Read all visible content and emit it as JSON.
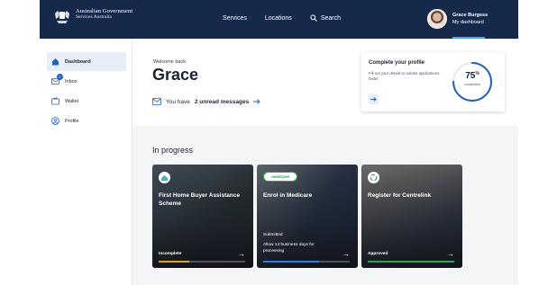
{
  "header": {
    "logo_line1": "Australian Government",
    "logo_line2": "Services Australia",
    "nav": [
      "Services",
      "Locations",
      "Search"
    ],
    "user_name": "Grace Burgess",
    "user_link": "My dashboard"
  },
  "sidebar": {
    "items": [
      {
        "label": "Dashboard",
        "icon": "home-icon",
        "active": true
      },
      {
        "label": "Inbox",
        "icon": "mail-icon",
        "badge": "2"
      },
      {
        "label": "Wallet",
        "icon": "wallet-icon"
      },
      {
        "label": "Profile",
        "icon": "user-icon"
      }
    ]
  },
  "main": {
    "welcome": "Welcome back",
    "name": "Grace",
    "unread_prefix": "You have",
    "unread_count": "2 unread messages",
    "profile": {
      "title": "Complete your profile",
      "desc": "Fill out your details to submit applications faster",
      "percent": "75",
      "percent_sign": "%",
      "percent_label": "completed",
      "progress_fraction": 0.75
    },
    "in_progress_title": "In progress",
    "cards": [
      {
        "title": "First Home Buyer Assistance Scheme",
        "status": "Incomplete",
        "bar_color": "#e0a21a",
        "bar_fraction": 0.35,
        "chip": "fhba-logo"
      },
      {
        "title": "Enrol in Medicare",
        "sub_status": "Submitted",
        "sub_desc": "Allow 14 business days for processing",
        "bar_color": "#2f7de1",
        "bar_fraction": 0.65,
        "chip_text": "medicare"
      },
      {
        "title": "Register for Centrelink",
        "status": "Approved",
        "bar_color": "#2ea44f",
        "bar_fraction": 1.0,
        "chip": "centrelink-logo"
      }
    ]
  },
  "colors": {
    "header_bg": "#17294a",
    "accent": "#1f5fb8",
    "medicare_green": "#1db233"
  }
}
